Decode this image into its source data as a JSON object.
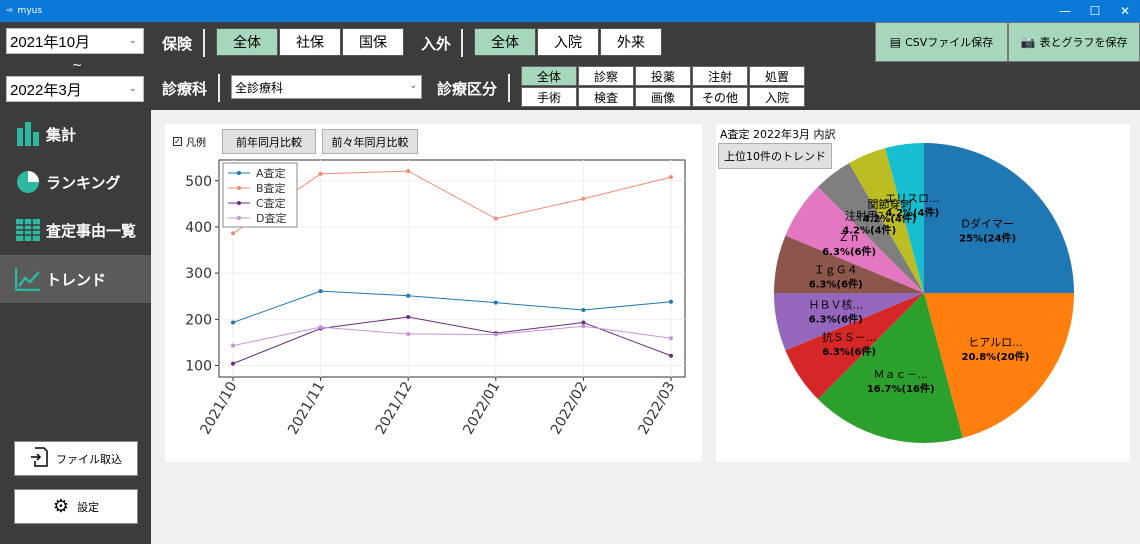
{
  "window": {
    "title": "myus",
    "minimize": "—",
    "maximize": "☐",
    "close": "✕"
  },
  "filters": {
    "start_month": "2021年10月",
    "range_sep": "~",
    "end_month": "2022年3月",
    "insurance_label": "保険",
    "insurance_options": [
      {
        "label": "全体",
        "active": true
      },
      {
        "label": "社保",
        "active": false
      },
      {
        "label": "国保",
        "active": false
      }
    ],
    "inout_label": "入外",
    "inout_options": [
      {
        "label": "全体",
        "active": true
      },
      {
        "label": "入院",
        "active": false
      },
      {
        "label": "外来",
        "active": false
      }
    ],
    "dept_label": "診療科",
    "dept_value": "全診療科",
    "category_label": "診療区分",
    "categories": [
      {
        "label": "全体",
        "active": true
      },
      {
        "label": "診察",
        "active": false
      },
      {
        "label": "投薬",
        "active": false
      },
      {
        "label": "注射",
        "active": false
      },
      {
        "label": "処置",
        "active": false
      },
      {
        "label": "手術",
        "active": false
      },
      {
        "label": "検査",
        "active": false
      },
      {
        "label": "画像",
        "active": false
      },
      {
        "label": "その他",
        "active": false
      },
      {
        "label": "入院",
        "active": false
      }
    ]
  },
  "actions": {
    "csv_save": "CSVファイル保存",
    "image_save": "表とグラフを保存"
  },
  "nav": [
    {
      "label": "集計",
      "active": false
    },
    {
      "label": "ランキング",
      "active": false
    },
    {
      "label": "査定事由一覧",
      "active": false
    },
    {
      "label": "トレンド",
      "active": true
    }
  ],
  "sidebar_buttons": {
    "import": "ファイル取込",
    "settings": "設定"
  },
  "line_panel": {
    "legend_toggle": "凡例",
    "compare_prev_year": "前年同月比較",
    "compare_two_years": "前々年同月比較"
  },
  "pie_panel": {
    "title": "A査定 2022年3月 内訳",
    "trend_button": "上位10件のトレンド"
  },
  "colors": {
    "accent": "#a6d6bc",
    "titlebar": "#0a79d8",
    "sidebar": "#3c3c3c",
    "series": [
      "#1f77b4",
      "#ff7f0e",
      "#2ca02c",
      "#d62728",
      "#9467bd",
      "#8c564b",
      "#e377c2",
      "#7f7f7f",
      "#bcbd22",
      "#17becf"
    ]
  },
  "chart_data": [
    {
      "type": "line",
      "x": [
        "2021/10",
        "2021/11",
        "2021/12",
        "2022/01",
        "2022/02",
        "2022/03"
      ],
      "series": [
        {
          "name": "A査定",
          "color": "#1f77b4",
          "values": [
            193,
            261,
            251,
            236,
            220,
            238
          ]
        },
        {
          "name": "B査定",
          "color": "#f08a72",
          "values": [
            386,
            515,
            521,
            418,
            461,
            508
          ]
        },
        {
          "name": "C査定",
          "color": "#6b2c85",
          "values": [
            104,
            180,
            205,
            170,
            193,
            121
          ]
        },
        {
          "name": "D査定",
          "color": "#c395d6",
          "values": [
            143,
            183,
            168,
            167,
            185,
            159
          ]
        }
      ],
      "yticks": [
        100,
        200,
        300,
        400,
        500
      ],
      "ylim": [
        75,
        545
      ],
      "grid": true,
      "legend": "top-left"
    },
    {
      "type": "pie",
      "slices": [
        {
          "label": "Dダイマー",
          "pct": "25%",
          "count": "24件",
          "value": 24,
          "color": "#1f77b4"
        },
        {
          "label": "ヒアルロ...",
          "pct": "20.8%",
          "count": "20件",
          "value": 20,
          "color": "#ff7f0e"
        },
        {
          "label": "Ｍａｃ－...",
          "pct": "16.7%",
          "count": "16件",
          "value": 16,
          "color": "#2ca02c"
        },
        {
          "label": "抗ＳＳ－...",
          "pct": "6.3%",
          "count": "6件",
          "value": 6,
          "color": "#d62728"
        },
        {
          "label": "ＨＢＶ核...",
          "pct": "6.3%",
          "count": "6件",
          "value": 6,
          "color": "#9467bd"
        },
        {
          "label": "ＩｇＧ４",
          "pct": "6.3%",
          "count": "6件",
          "value": 6,
          "color": "#8c564b"
        },
        {
          "label": "Ｚｎ",
          "pct": "6.3%",
          "count": "6件",
          "value": 6,
          "color": "#e377c2"
        },
        {
          "label": "注射用ﾌ...",
          "pct": "4.2%",
          "count": "4件",
          "value": 4,
          "color": "#7f7f7f"
        },
        {
          "label": "関節穿刺",
          "pct": "4.2%",
          "count": "4件",
          "value": 4,
          "color": "#bcbd22"
        },
        {
          "label": "エリスロ...",
          "pct": "4.2%",
          "count": "4件",
          "value": 4,
          "color": "#17becf"
        }
      ]
    }
  ]
}
